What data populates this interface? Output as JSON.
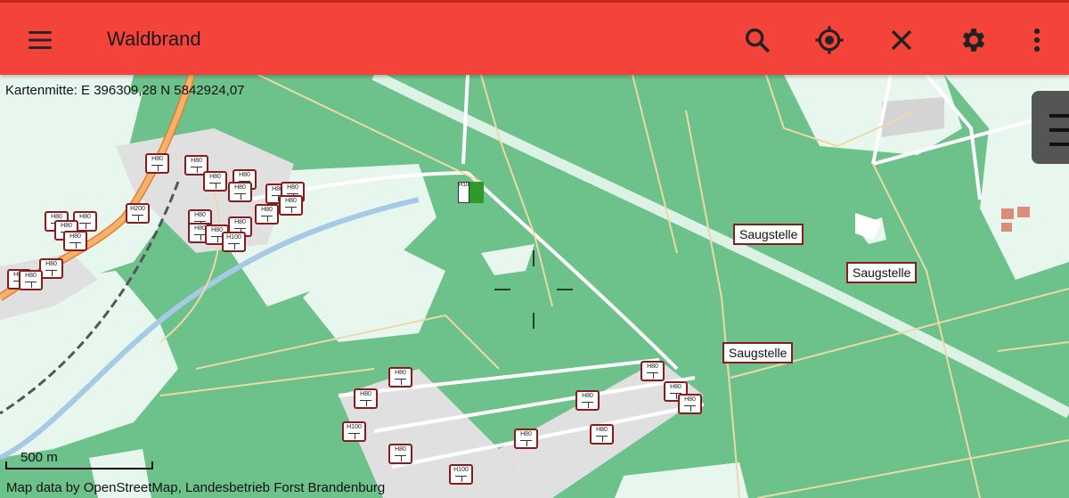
{
  "appbar": {
    "title": "Waldbrand",
    "icons": [
      "menu-icon",
      "search-icon",
      "gps-locate-icon",
      "close-icon",
      "settings-icon",
      "more-vert-icon"
    ],
    "color": "#f4433a"
  },
  "map": {
    "center_readout": "Kartenmitte: E 396309,28 N 5842924,07",
    "scale_label": "500 m",
    "attribution": "Map data by OpenStreetMap, Landesbetrieb Forst Brandenburg",
    "colors": {
      "forest": "#6cc28a",
      "meadow": "#e8f7ee",
      "water": "#a6c9e6",
      "residential": "#e0e0e0",
      "road_major": "#f0a04b"
    },
    "hydrants": [
      {
        "label": "H80"
      },
      {
        "label": "H80"
      },
      {
        "label": "H80"
      },
      {
        "label": "H80"
      },
      {
        "label": "H80"
      },
      {
        "label": "H80"
      },
      {
        "label": "H80"
      },
      {
        "label": "H80"
      },
      {
        "label": "H80"
      },
      {
        "label": "H200"
      },
      {
        "label": "H80"
      },
      {
        "label": "H80"
      },
      {
        "label": "H80"
      },
      {
        "label": "H80"
      },
      {
        "label": "H80"
      },
      {
        "label": "H100"
      },
      {
        "label": "H80"
      },
      {
        "label": "H80"
      },
      {
        "label": "H80"
      },
      {
        "label": "H80"
      },
      {
        "label": "H80"
      },
      {
        "label": "H80"
      },
      {
        "label": "H80"
      },
      {
        "label": "H80"
      },
      {
        "label": "H80"
      },
      {
        "label": "H80"
      },
      {
        "label": "H80"
      },
      {
        "label": "H80"
      },
      {
        "label": "H80"
      },
      {
        "label": "H80"
      },
      {
        "label": "H100"
      }
    ],
    "suction_points": [
      "Saugstelle",
      "Saugstelle",
      "Saugstelle"
    ],
    "station_label": "H100"
  }
}
